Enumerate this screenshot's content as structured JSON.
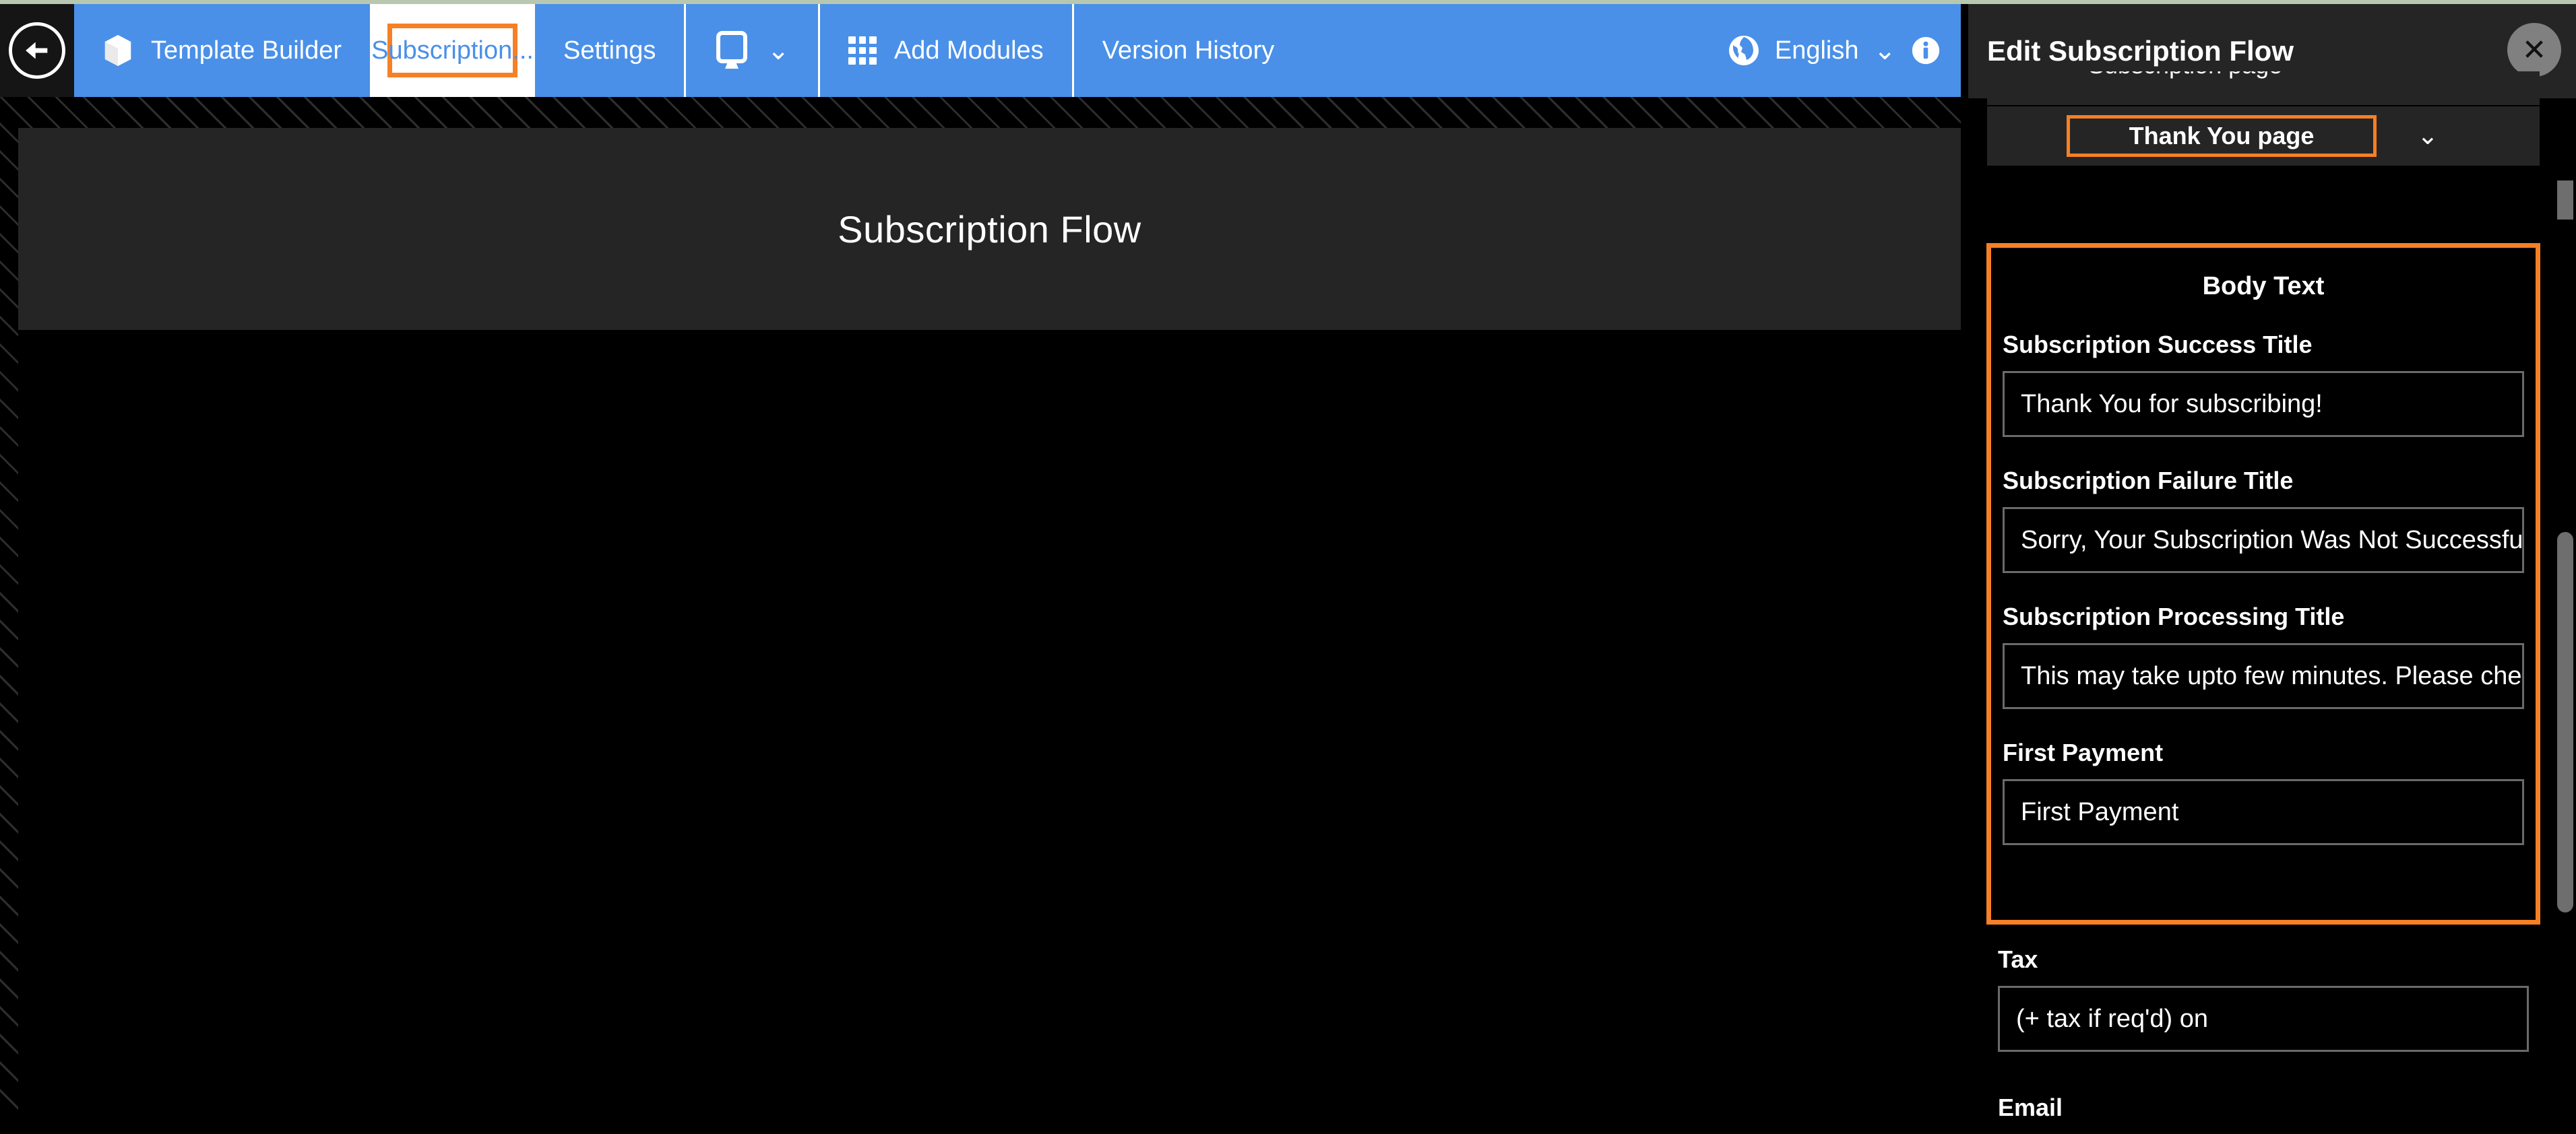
{
  "topbar": {
    "back_icon": "back-arrow-icon",
    "items": [
      {
        "id": "template-builder",
        "label": "Template Builder",
        "icon": "cube-icon"
      },
      {
        "id": "subscription",
        "label": "Subscription...",
        "selected": true
      },
      {
        "id": "settings",
        "label": "Settings"
      },
      {
        "id": "device-preview",
        "label": "",
        "icon": "monitor-icon",
        "chevron": "⌄"
      },
      {
        "id": "add-modules",
        "label": "Add Modules",
        "icon": "grid-icon"
      },
      {
        "id": "version-history",
        "label": "Version History"
      }
    ],
    "language": {
      "icon": "globe-icon",
      "label": "English",
      "chevron": "⌄",
      "info_icon": "info-icon"
    }
  },
  "canvas": {
    "title": "Subscription Flow"
  },
  "panel": {
    "title": "Edit Subscription Flow",
    "close_label": "✕",
    "cutoff_row_text": "Subscription page",
    "page_selector": {
      "value": "Thank You page",
      "chevron": "⌄"
    },
    "body_group": {
      "title": "Body Text",
      "fields": [
        {
          "label": "Subscription Success Title",
          "value": "Thank You for subscribing!"
        },
        {
          "label": "Subscription Failure Title",
          "value": "Sorry, Your Subscription Was Not Successful."
        },
        {
          "label": "Subscription Processing Title",
          "value": "This may take upto few minutes. Please check"
        },
        {
          "label": "First Payment",
          "value": "First Payment"
        }
      ]
    },
    "extra_fields": [
      {
        "label": "Tax",
        "value": "(+ tax if req'd) on"
      },
      {
        "label": "Email",
        "value": ""
      }
    ]
  },
  "colors": {
    "accent_blue": "#4a90e8",
    "highlight_orange": "#f58025",
    "panel_bg": "#000000",
    "header_bg": "#252525"
  }
}
